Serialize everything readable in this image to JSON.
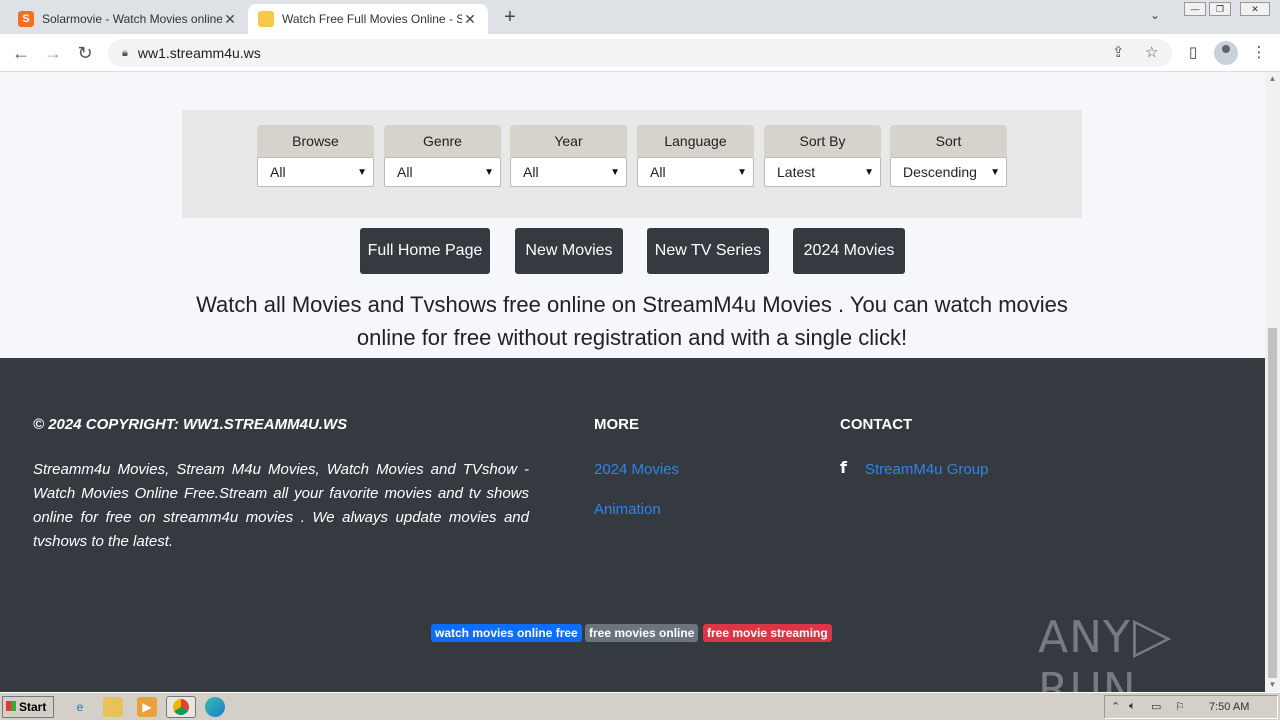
{
  "browser": {
    "tabs": [
      {
        "title": "Solarmovie - Watch Movies online Ho",
        "favicon": "S",
        "favicon_color": "#f37021"
      },
      {
        "title": "Watch Free Full Movies Online - Stre",
        "favicon": "",
        "favicon_color": "#f7c948"
      }
    ],
    "new_tab": "+",
    "url": "ww1.streamm4u.ws",
    "window_controls": [
      "—",
      "❐",
      "✕"
    ]
  },
  "filters": [
    {
      "label": "Browse",
      "value": "All"
    },
    {
      "label": "Genre",
      "value": "All"
    },
    {
      "label": "Year",
      "value": "All"
    },
    {
      "label": "Language",
      "value": "All"
    },
    {
      "label": "Sort By",
      "value": "Latest"
    },
    {
      "label": "Sort",
      "value": "Descending"
    }
  ],
  "nav_buttons": [
    "Full Home Page",
    "New Movies",
    "New TV Series",
    "2024 Movies"
  ],
  "tagline": "Watch all Movies and Tvshows free online on StreamM4u Movies . You can watch movies online for free without registration and with a single click!",
  "footer": {
    "copyright": "© 2024 COPYRIGHT: WW1.STREAMM4U.WS",
    "about": "Streamm4u Movies, Stream M4u Movies, Watch Movies and TVshow - Watch Movies Online Free.Stream all your favorite movies and tv shows online for free on streamm4u movies . We always update movies and tvshows to the latest.",
    "more_heading": "MORE",
    "more_links": [
      "2024 Movies",
      "Animation"
    ],
    "contact_heading": "CONTACT",
    "contact_link": "StreamM4u Group",
    "badges": [
      {
        "text": "watch movies online free",
        "color": "#0d6efd"
      },
      {
        "text": "free movies online",
        "color": "#6c757d"
      },
      {
        "text": "free movie streaming",
        "color": "#dc3545"
      }
    ]
  },
  "watermark": {
    "left": "ANY",
    "right": "RUN"
  },
  "taskbar": {
    "start_label": "Start",
    "clock": "7:50 AM"
  }
}
